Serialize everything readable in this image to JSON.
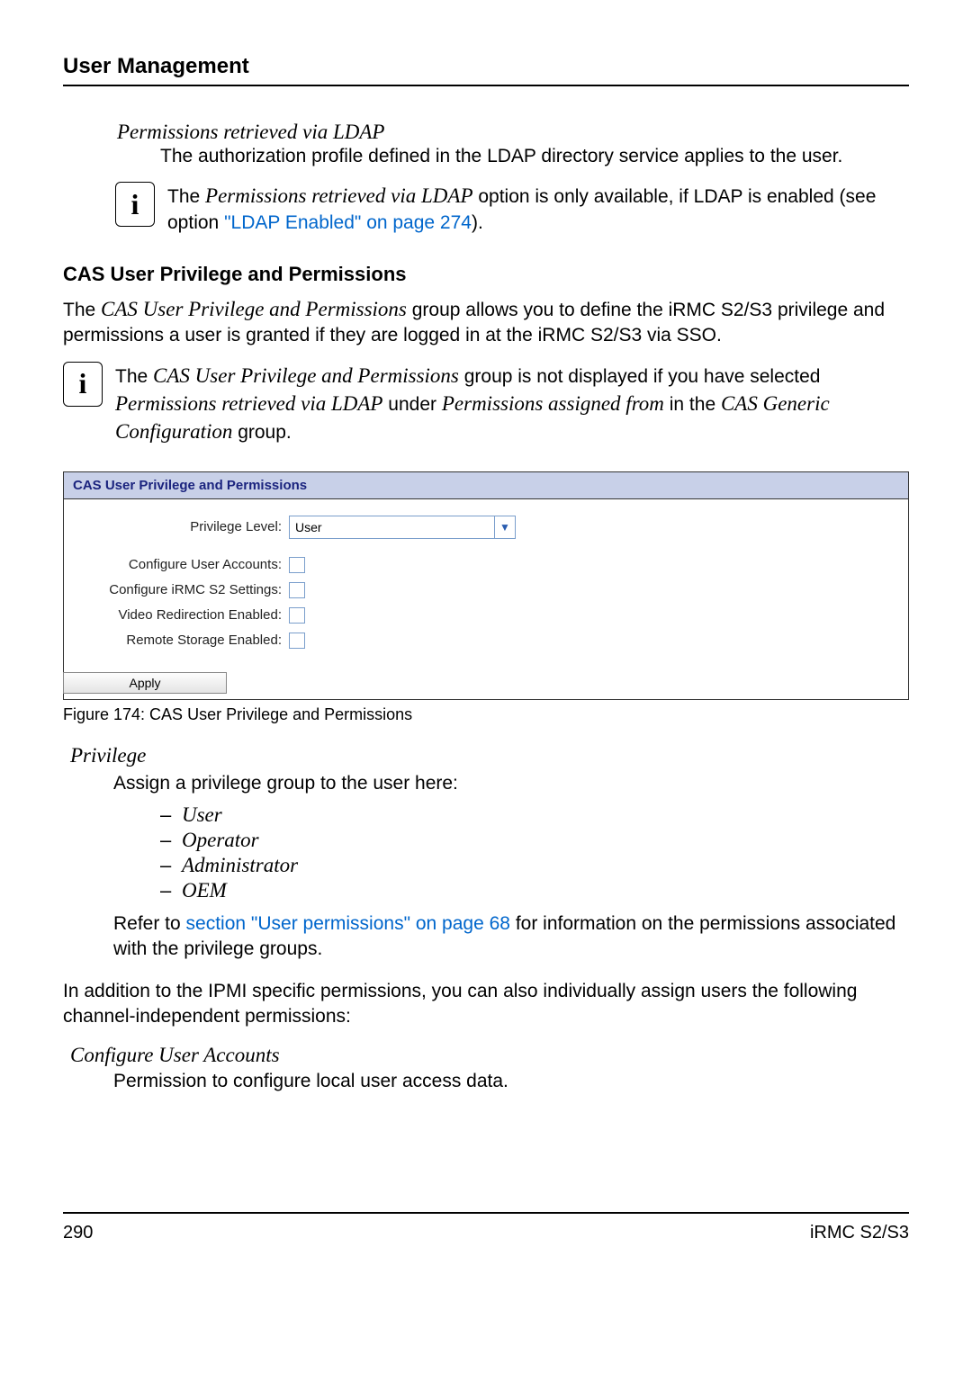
{
  "header": {
    "title": "User Management"
  },
  "perm_ldap": {
    "title": "Permissions retrieved via LDAP",
    "desc": "The authorization profile defined in the LDAP directory service applies to the user."
  },
  "note1": {
    "pre": "The ",
    "em1": "Permissions retrieved via LDAP",
    "mid": " option is only available, if LDAP is enabled (see option ",
    "link": "\"LDAP Enabled\" on page 274",
    "post": ")."
  },
  "cas": {
    "heading": "CAS User Privilege and Permissions",
    "para_pre": "The ",
    "para_em": "CAS User Privilege and Permissions",
    "para_post": " group allows you to define the iRMC S2/S3 privilege and permissions a user is granted if they are logged in at the iRMC S2/S3 via SSO."
  },
  "note2": {
    "pre": "The ",
    "em1": "CAS User Privilege and Permissions",
    "mid1": " group is not displayed if you have selected ",
    "em2": "Permissions retrieved via LDAP",
    "mid2": " under ",
    "em3": "Permissions assigned from",
    "mid3": " in the ",
    "em4": "CAS Generic Configuration",
    "post": " group."
  },
  "panel": {
    "title": "CAS User Privilege and Permissions",
    "privilege_label": "Privilege Level:",
    "privilege_value": "User",
    "rows": {
      "cua": "Configure User Accounts:",
      "cirmc": "Configure iRMC S2 Settings:",
      "vre": "Video Redirection Enabled:",
      "rse": "Remote Storage Enabled:"
    },
    "apply": "Apply"
  },
  "figure_caption": "Figure 174: CAS User Privilege and Permissions",
  "privilege": {
    "title": "Privilege",
    "desc": "Assign a privilege group to the user here:",
    "items": [
      "User",
      "Operator",
      "Administrator",
      "OEM"
    ],
    "refer_pre": "Refer to ",
    "refer_link": "section \"User permissions\" on page 68",
    "refer_post": " for information on the permissions associated with the privilege groups."
  },
  "addition": "In addition to the IPMI specific permissions, you can also individually assign users the following channel-independent permissions:",
  "cua": {
    "title": "Configure User Accounts",
    "desc": "Permission to configure local user access data."
  },
  "footer": {
    "page": "290",
    "doc": "iRMC S2/S3"
  }
}
